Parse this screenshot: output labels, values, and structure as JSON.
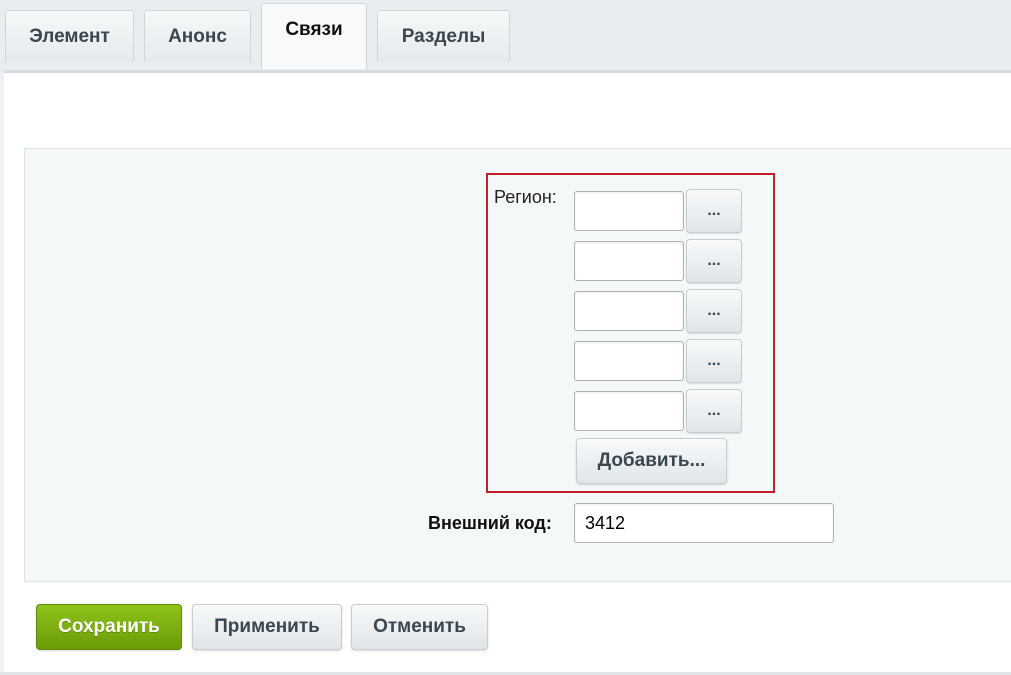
{
  "tabs": [
    {
      "label": "Элемент"
    },
    {
      "label": "Анонс"
    },
    {
      "label": "Связи",
      "active": true
    },
    {
      "label": "Разделы"
    }
  ],
  "form": {
    "region_label": "Регион:",
    "region_inputs": [
      "",
      "",
      "",
      "",
      ""
    ],
    "browse_label": "...",
    "add_label": "Добавить...",
    "external_code_label": "Внешний код:",
    "external_code_value": "3412"
  },
  "actions": {
    "save": "Сохранить",
    "apply": "Применить",
    "cancel": "Отменить"
  },
  "colors": {
    "highlight": "#c21f29",
    "save_green": "#7aae10"
  }
}
